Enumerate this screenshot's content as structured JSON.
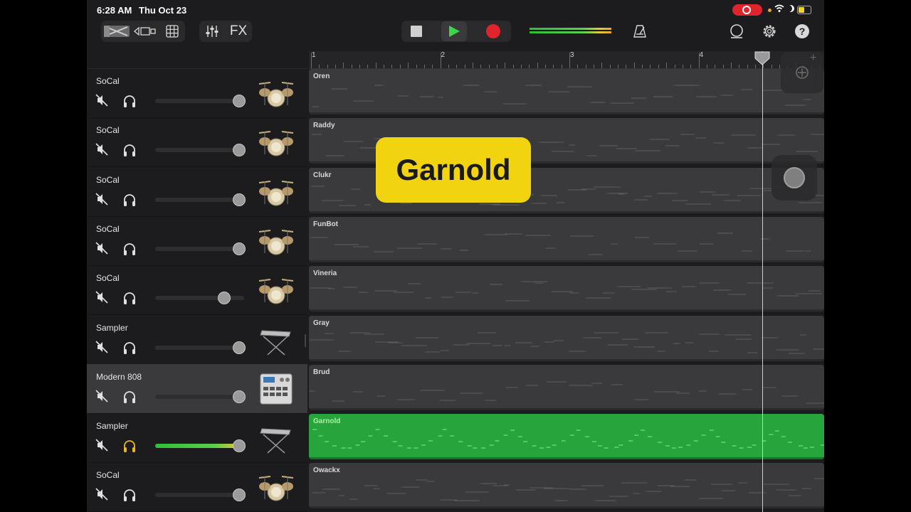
{
  "status": {
    "time": "6:28 AM",
    "date": "Thu Oct 23"
  },
  "toolbar": {
    "fx_label": "FX"
  },
  "overlay": {
    "label": "Garnold"
  },
  "ruler": {
    "bars": [
      "1",
      "2",
      "3",
      "4"
    ]
  },
  "tracks": [
    {
      "name": "SoCal",
      "instrument": "drum-kit-icon",
      "region": "Oren",
      "volume": 1.0,
      "selected": false,
      "active": false
    },
    {
      "name": "SoCal",
      "instrument": "drum-kit-icon",
      "region": "Raddy",
      "volume": 1.0,
      "selected": false,
      "active": false
    },
    {
      "name": "SoCal",
      "instrument": "drum-kit-icon",
      "region": "Clukr",
      "volume": 1.0,
      "selected": false,
      "active": false
    },
    {
      "name": "SoCal",
      "instrument": "drum-kit-icon",
      "region": "FunBot",
      "volume": 1.0,
      "selected": false,
      "active": false
    },
    {
      "name": "SoCal",
      "instrument": "drum-kit-icon",
      "region": "Vineria",
      "volume": 0.8,
      "selected": false,
      "active": false
    },
    {
      "name": "Sampler",
      "instrument": "keyboard-icon",
      "region": "Gray",
      "volume": 1.0,
      "selected": false,
      "active": false
    },
    {
      "name": "Modern 808",
      "instrument": "drum-machine-icon",
      "region": "Brud",
      "volume": 1.0,
      "selected": true,
      "active": false
    },
    {
      "name": "Sampler",
      "instrument": "keyboard-icon",
      "region": "Garnold",
      "volume": 1.0,
      "selected": false,
      "active": true
    },
    {
      "name": "SoCal",
      "instrument": "drum-kit-icon",
      "region": "Owackx",
      "volume": 1.0,
      "selected": false,
      "active": false
    }
  ],
  "colors": {
    "accent_green": "#28a43c",
    "record_red": "#e0242c",
    "callout_yellow": "#f1d40f",
    "headphones_active": "#e8b820"
  }
}
